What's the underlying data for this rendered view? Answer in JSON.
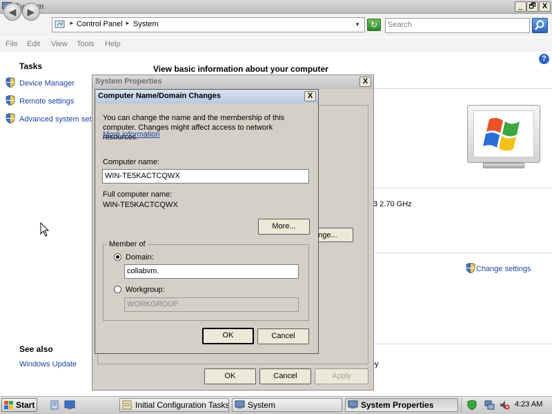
{
  "window": {
    "title": "System",
    "controls": {
      "minimize": "_",
      "maximize": "🗗",
      "close": "X"
    }
  },
  "address_bar": {
    "crumbs": [
      "Control Panel",
      "System"
    ],
    "search_placeholder": "Search"
  },
  "menu": [
    "File",
    "Edit",
    "View",
    "Tools",
    "Help"
  ],
  "help_icon": "?",
  "left_pane": {
    "tasks_title": "Tasks",
    "tasks": [
      "Device Manager",
      "Remote settings",
      "Advanced system set"
    ],
    "see_also_title": "See also",
    "see_also": [
      "Windows Update"
    ]
  },
  "main": {
    "heading": "View basic information about your computer",
    "fragments": {
      "computer": "computer",
      "r": "r",
      "cpu": "3  2.70 GHz",
      "change_settings": "Change settings",
      "ey": "ey",
      "change_btn": "ange..."
    }
  },
  "system_properties": {
    "title": "System Properties",
    "close": "X",
    "buttons": {
      "ok": "OK",
      "cancel": "Cancel",
      "apply": "Apply"
    }
  },
  "name_dialog": {
    "title": "Computer Name/Domain Changes",
    "close": "X",
    "info_line1": "You can change the name and the membership of this",
    "info_line2": "computer. Changes might affect access to network resources.",
    "more_info_link": "More information",
    "computer_name_label": "Computer name:",
    "computer_name_value": "WIN-TE5KACTCQWX",
    "full_name_label": "Full computer name:",
    "full_name_value": "WIN-TE5KACTCQWX",
    "more_button": "More...",
    "member_of_label": "Member of",
    "domain_label": "Domain:",
    "domain_value": "collabvm.",
    "domain_selected": true,
    "workgroup_label": "Workgroup:",
    "workgroup_value": "WORKGROUP",
    "ok": "OK",
    "cancel": "Cancel"
  },
  "taskbar": {
    "start": "Start",
    "buttons": [
      {
        "label": "Initial Configuration Tasks",
        "active": false
      },
      {
        "label": "System",
        "active": false
      },
      {
        "label": "System Properties",
        "active": true
      }
    ],
    "clock": "4:23 AM"
  },
  "colors": {
    "link": "#1a43a0",
    "dialog_face": "#d4d0c8",
    "title_active": "#b8c8de"
  },
  "icons": {
    "app": "computer-icon",
    "address": "control-panel-icon",
    "refresh": "refresh-icon",
    "search": "search-icon",
    "tasks": "uac-shield-icon",
    "logo": "windows-logo"
  }
}
